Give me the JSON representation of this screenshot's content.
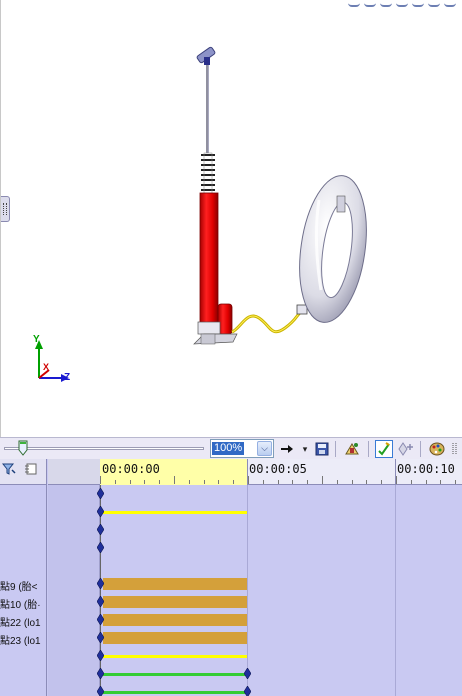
{
  "viewport": {
    "axes": {
      "y": "Y",
      "x": "X",
      "z": "Z"
    }
  },
  "toolbar": {
    "zoom": {
      "value": "100%",
      "arrow": "⌵"
    },
    "icons": [
      "arrow-right-icon",
      "save-icon",
      "scene-icon",
      "keyframe-on-icon",
      "add-keyframe-icon",
      "palette-icon"
    ],
    "slider_position_fraction": 0.1
  },
  "timeline": {
    "ruler": {
      "labels": [
        "00:00:00",
        "00:00:05",
        "00:00:10"
      ]
    },
    "objects": [
      {
        "label": ""
      },
      {
        "label": ""
      },
      {
        "label": ""
      },
      {
        "label": ""
      },
      {
        "label": ""
      },
      {
        "label": "點9 (胎<"
      },
      {
        "label": "點10 (胎·"
      },
      {
        "label": "點22 (lo1"
      },
      {
        "label": "點23 (lo1"
      },
      {
        "label": ""
      },
      {
        "label": ""
      },
      {
        "label": ""
      }
    ],
    "colors": {
      "gold": "#d4a03a",
      "yellow": "#ffff00",
      "green": "#33cc33",
      "key": "#1f2f9a"
    }
  }
}
